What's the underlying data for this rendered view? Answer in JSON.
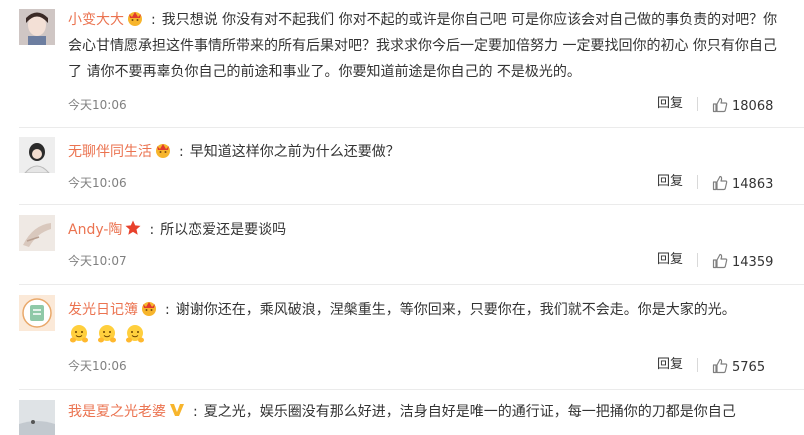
{
  "comments": [
    {
      "username": "小变大大",
      "text": "我只想说 你没有对不起我们 你对不起的或许是你自己吧 可是你应该会对自己做的事负责的对吧？你会心甘情愿承担这件事情所带来的所有后果对吧？我求求你今后一定要加倍努力 一定要找回你的初心 你只有你自己了 请你不要再辜负你自己的前途和事业了。你要知道前途是你自己的 不是极光的。",
      "time": "今天10:06",
      "reply_label": "回复",
      "likes": "18068",
      "badge_icon": "crown-face-icon"
    },
    {
      "username": "无聊伴同生活",
      "text": "早知道这样你之前为什么还要做？",
      "time": "今天10:06",
      "reply_label": "回复",
      "likes": "14863",
      "badge_icon": "crown-face-icon"
    },
    {
      "username": "Andy-陶",
      "text": "所以恋爱还是要谈吗",
      "time": "今天10:07",
      "reply_label": "回复",
      "likes": "14359",
      "badge_icon": "red-star-icon"
    },
    {
      "username": "发光日记簿",
      "text": "谢谢你还在，乘风破浪，涅槃重生，等你回来，只要你在，我们就不会走。你是大家的光。",
      "emojis": [
        "hug-emoji-icon",
        "hug-emoji-icon",
        "hug-emoji-icon"
      ],
      "time": "今天10:06",
      "reply_label": "回复",
      "likes": "5765",
      "badge_icon": "crown-face-icon"
    },
    {
      "username": "我是夏之光老婆",
      "text": "夏之光，娱乐圈没有那么好进，洁身自好是唯一的通行证，每一把捅你的刀都是你自己",
      "badge_icon": "v-badge-icon"
    }
  ],
  "colors": {
    "username": "#eb7350",
    "text": "#333333",
    "muted": "#808080",
    "divider": "#ebebeb"
  }
}
